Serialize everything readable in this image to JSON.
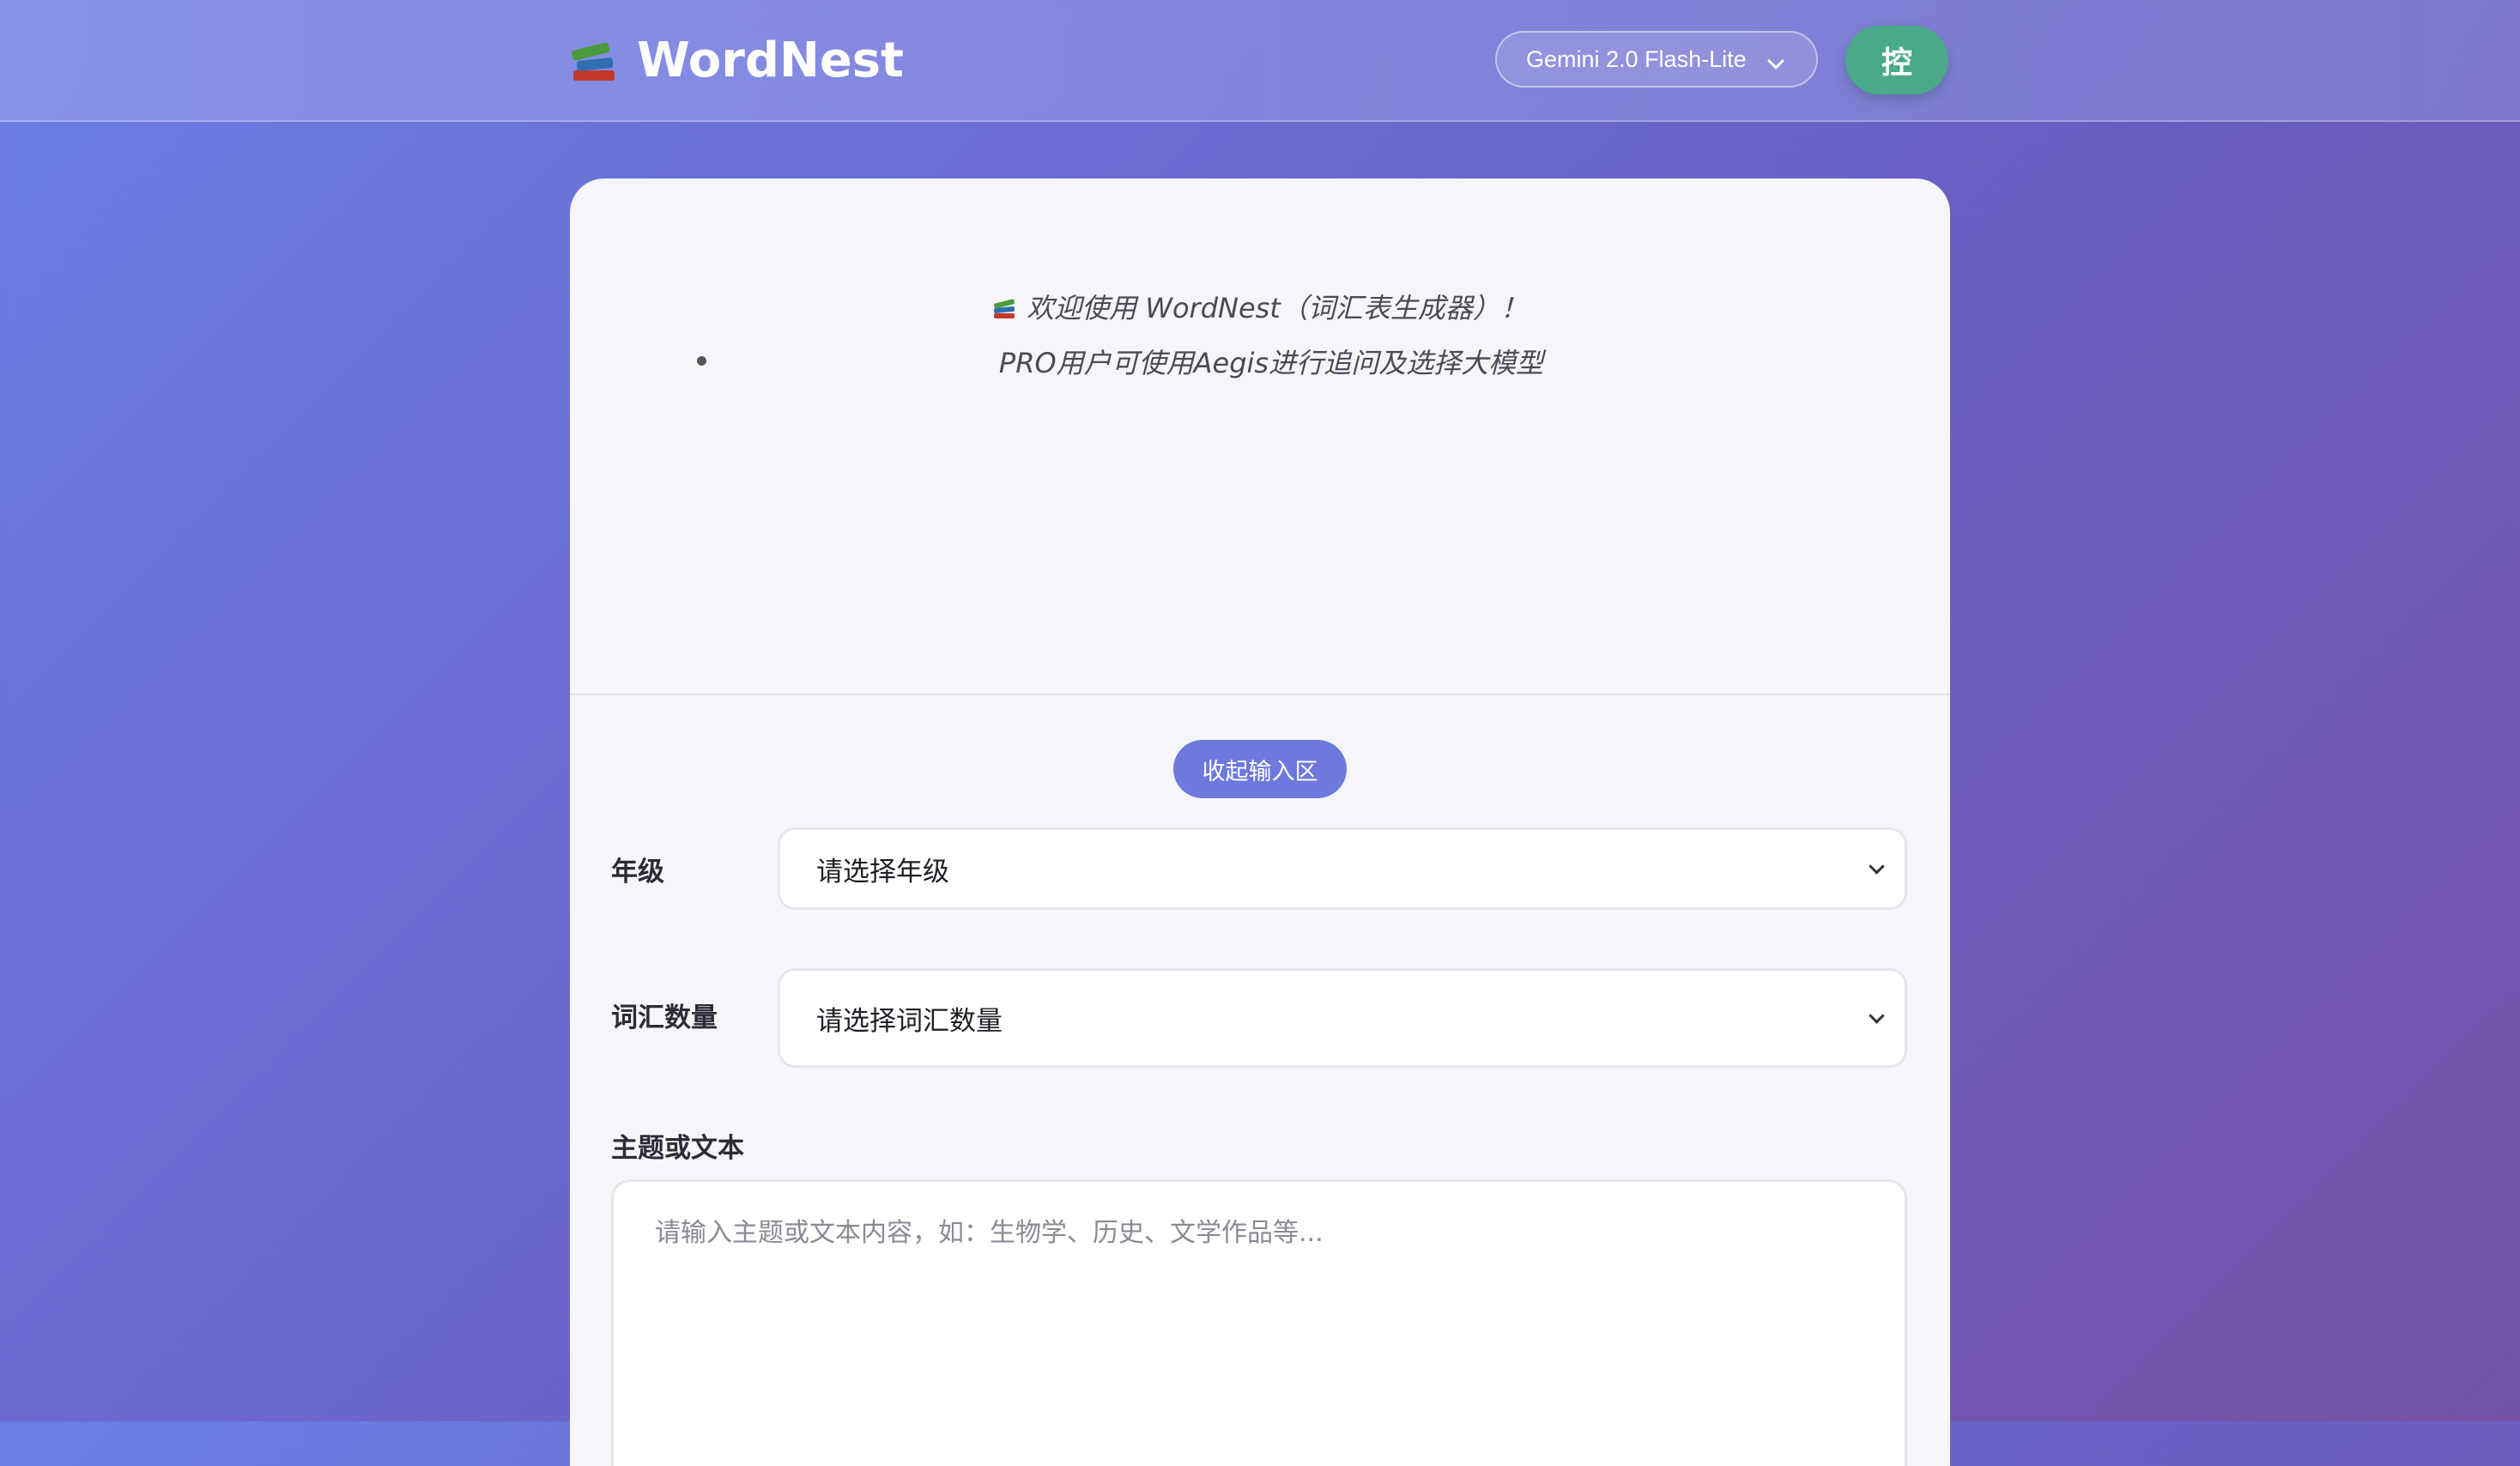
{
  "header": {
    "app_name": "WordNest",
    "logo_icon": "books-icon",
    "model_selector": {
      "selected": "Gemini 2.0 Flash-Lite"
    },
    "avatar_label": "控",
    "avatar_color": "#49a98a"
  },
  "welcome": {
    "line1": "欢迎使用 WordNest（词汇表生成器）！",
    "line2": "PRO用户可使用Aegis进行追问及选择大模型"
  },
  "form": {
    "collapse_label": "收起输入区",
    "grade": {
      "label": "年级",
      "selected": "请选择年级"
    },
    "vocab_count": {
      "label": "词汇数量",
      "selected": "请选择词汇数量"
    },
    "topic": {
      "label": "主题或文本",
      "placeholder": "请输入主题或文本内容，如：生物学、历史、文学作品等..."
    }
  },
  "colors": {
    "accent": "#6d79dc",
    "background_start": "#6b7fe3",
    "background_end": "#7352a6"
  }
}
